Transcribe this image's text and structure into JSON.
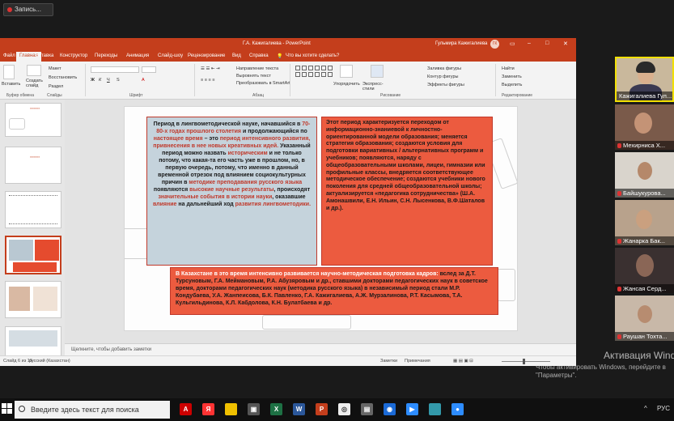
{
  "zoom": {
    "recording_label": "Запись...",
    "watermark_title": "Активация Windows",
    "watermark_sub": "Чтобы активировать Windows, перейдите в \"Параметры\"."
  },
  "ppt": {
    "window_title": "Г.А. Кажигалиева  -  PowerPoint",
    "search_placeholder": "Что вы хотите сделать?",
    "user_name": "Гульмира Кажигалиева",
    "user_initials": "ГК",
    "tabs": [
      "Файл",
      "Главная",
      "Вставка",
      "Конструктор",
      "Переходы",
      "Анимация",
      "Слайд-шоу",
      "Рецензирование",
      "Вид",
      "Справка"
    ],
    "ribbon": {
      "paste": "Вставить",
      "create_slide": "Создать слайд",
      "cut": "Макет",
      "copy": "Восстановить",
      "reset": "Раздел",
      "group_clipboard": "Буфер обмена",
      "group_slides": "Слайды",
      "group_font": "Шрифт",
      "group_paragraph": "Абзац",
      "group_drawing": "Рисование",
      "group_editing": "Редактирование",
      "text_direction": "Направление текста",
      "align_text": "Выровнять текст",
      "smartart": "Преобразовать в SmartArt",
      "arrange": "Упорядочить",
      "quick_styles": "Экспресс-стили",
      "fill": "Заливка фигуры",
      "outline": "Контур фигуры",
      "effects": "Эффекты фигуры",
      "find": "Найти",
      "replace": "Заменить",
      "select": "Выделить"
    },
    "notes_placeholder": "Щелкните, чтобы добавить заметки",
    "status": {
      "slide_counter": "Слайд 6 из 19",
      "language": "русский (Казахстан)",
      "notes": "Заметки",
      "comments": "Примечания"
    },
    "slide": {
      "left_segments": [
        {
          "t": "Период в лингвометодической науке, начавшийся в ",
          "r": false
        },
        {
          "t": "70-80-х годах прошлого столетия",
          "r": true
        },
        {
          "t": " и продолжающийся по ",
          "r": false
        },
        {
          "t": "настоящее время",
          "r": true
        },
        {
          "t": " – это ",
          "r": false
        },
        {
          "t": "период интенсивного развития, привнесения в нее новых креативных идей.",
          "r": true
        },
        {
          "t": " Указанный период можно назвать ",
          "r": false
        },
        {
          "t": "историческим",
          "r": true
        },
        {
          "t": " и не только потому, что какая-та его часть уже в прошлом, но, в первую очередь, потому, что именно в данный временной отрезок под влиянием социокультурных причин в ",
          "r": false
        },
        {
          "t": "методике преподавания русского языка",
          "r": true
        },
        {
          "t": " появляются ",
          "r": false
        },
        {
          "t": "высокие научные результаты",
          "r": true
        },
        {
          "t": ", происходят ",
          "r": false
        },
        {
          "t": "значительные события в истории науки",
          "r": true
        },
        {
          "t": ", оказавшие ",
          "r": false
        },
        {
          "t": "влияние",
          "r": true
        },
        {
          "t": " на дальнейший ход ",
          "r": false
        },
        {
          "t": "развития лингвометодики.",
          "r": true
        }
      ],
      "right_text": "Этот период характеризуется переходом от информационно-знаниевой к личностно-ориентированной модели образования; меняется стратегия образования; создаются условия для подготовки вариативных / альтернативных программ и учебников; появляются, наряду с общеобразовательными школами, лицеи, гимназии или профильные классы, внедряется соответствующее методическое обеспечение; создаются учебники нового поколения для средней общеобразовательной школы; актуализируется «педагогика сотрудничества» (Ш.А. Амонашвили, Е.Н. Ильин, С.Н. Лысенкова, В.Ф.Шаталов и др.).",
      "bottom_lead": "В Казахстане в это время интенсивно развивается научно-методическая подготовка кадров:",
      "bottom_text": " вслед за Д.Т. Турсуновым, Г.А. Меймановым, Р.А. Абузяровым и др., ставшими докторами педагогических наук в советское время, докторами педагогических наук (методика русского языка) в независимый период стали М.Р. Кондубаева, У.А. Жанпеисова, Б.К. Павленко, Г.А. Кажигалиева, А.Ж. Мурзалинова, Р.Т. Касымова, Т.А. Кульгильдинова, К.Л. Кабдолова, К.Н. Булатбаева и др."
    }
  },
  "participants": [
    {
      "name": "Кажигалиева Гул..."
    },
    {
      "name": "Мехирниса Х..."
    },
    {
      "name": "Байшукурова..."
    },
    {
      "name": "Жанарка Бак..."
    },
    {
      "name": "Жансая Серд..."
    },
    {
      "name": "Раушан Тохта..."
    }
  ],
  "taskbar": {
    "search_placeholder": "Введите здесь текст для поиска",
    "lang": "РУС"
  },
  "colors": {
    "ppt_accent": "#c43e1c",
    "slide_red_box": "#ec5b3f",
    "slide_blue_box": "#c5d3dc",
    "active_speaker": "#f2e000"
  }
}
